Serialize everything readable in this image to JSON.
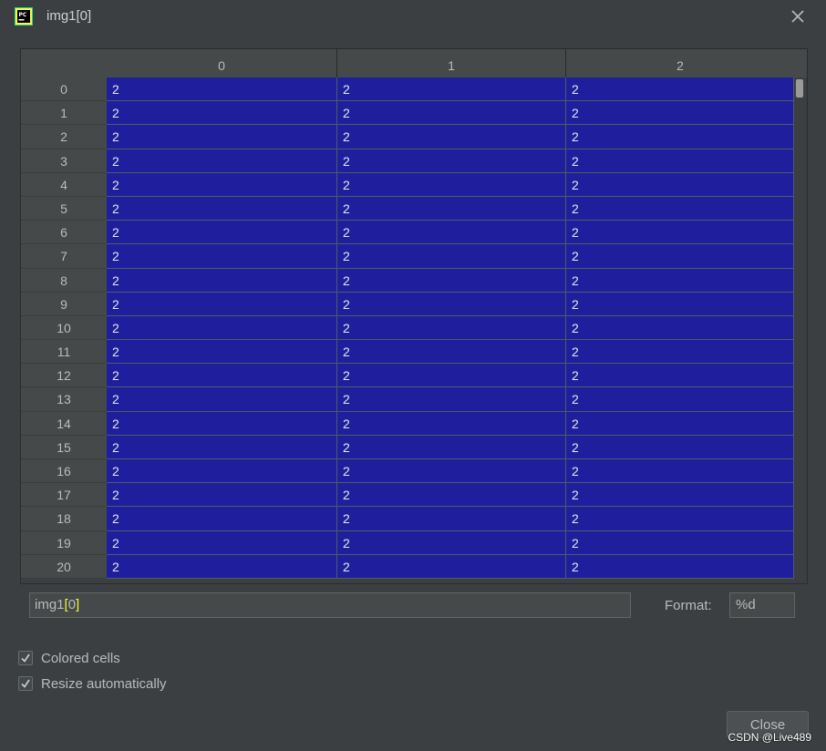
{
  "window": {
    "title": "img1[0]",
    "app_icon": "pycharm-icon",
    "close_icon": "close-icon"
  },
  "table": {
    "columns": [
      "0",
      "1",
      "2"
    ],
    "row_labels": [
      "0",
      "1",
      "2",
      "3",
      "4",
      "5",
      "6",
      "7",
      "8",
      "9",
      "10",
      "11",
      "12",
      "13",
      "14",
      "15",
      "16",
      "17",
      "18",
      "19",
      "20"
    ],
    "cells": [
      [
        "2",
        "2",
        "2"
      ],
      [
        "2",
        "2",
        "2"
      ],
      [
        "2",
        "2",
        "2"
      ],
      [
        "2",
        "2",
        "2"
      ],
      [
        "2",
        "2",
        "2"
      ],
      [
        "2",
        "2",
        "2"
      ],
      [
        "2",
        "2",
        "2"
      ],
      [
        "2",
        "2",
        "2"
      ],
      [
        "2",
        "2",
        "2"
      ],
      [
        "2",
        "2",
        "2"
      ],
      [
        "2",
        "2",
        "2"
      ],
      [
        "2",
        "2",
        "2"
      ],
      [
        "2",
        "2",
        "2"
      ],
      [
        "2",
        "2",
        "2"
      ],
      [
        "2",
        "2",
        "2"
      ],
      [
        "2",
        "2",
        "2"
      ],
      [
        "2",
        "2",
        "2"
      ],
      [
        "2",
        "2",
        "2"
      ],
      [
        "2",
        "2",
        "2"
      ],
      [
        "2",
        "2",
        "2"
      ],
      [
        "2",
        "2",
        "2"
      ]
    ],
    "cell_color": "#1f1f9e"
  },
  "expression": {
    "prefix": "img1",
    "bracket_open": "[",
    "index": "0",
    "bracket_close": "]"
  },
  "format": {
    "label": "Format:",
    "value": "%d"
  },
  "options": {
    "colored_cells": {
      "label": "Colored cells",
      "checked": true
    },
    "resize_automatically": {
      "label": "Resize automatically",
      "checked": true
    }
  },
  "buttons": {
    "close_label": "Close"
  },
  "watermark": "CSDN @Live489"
}
